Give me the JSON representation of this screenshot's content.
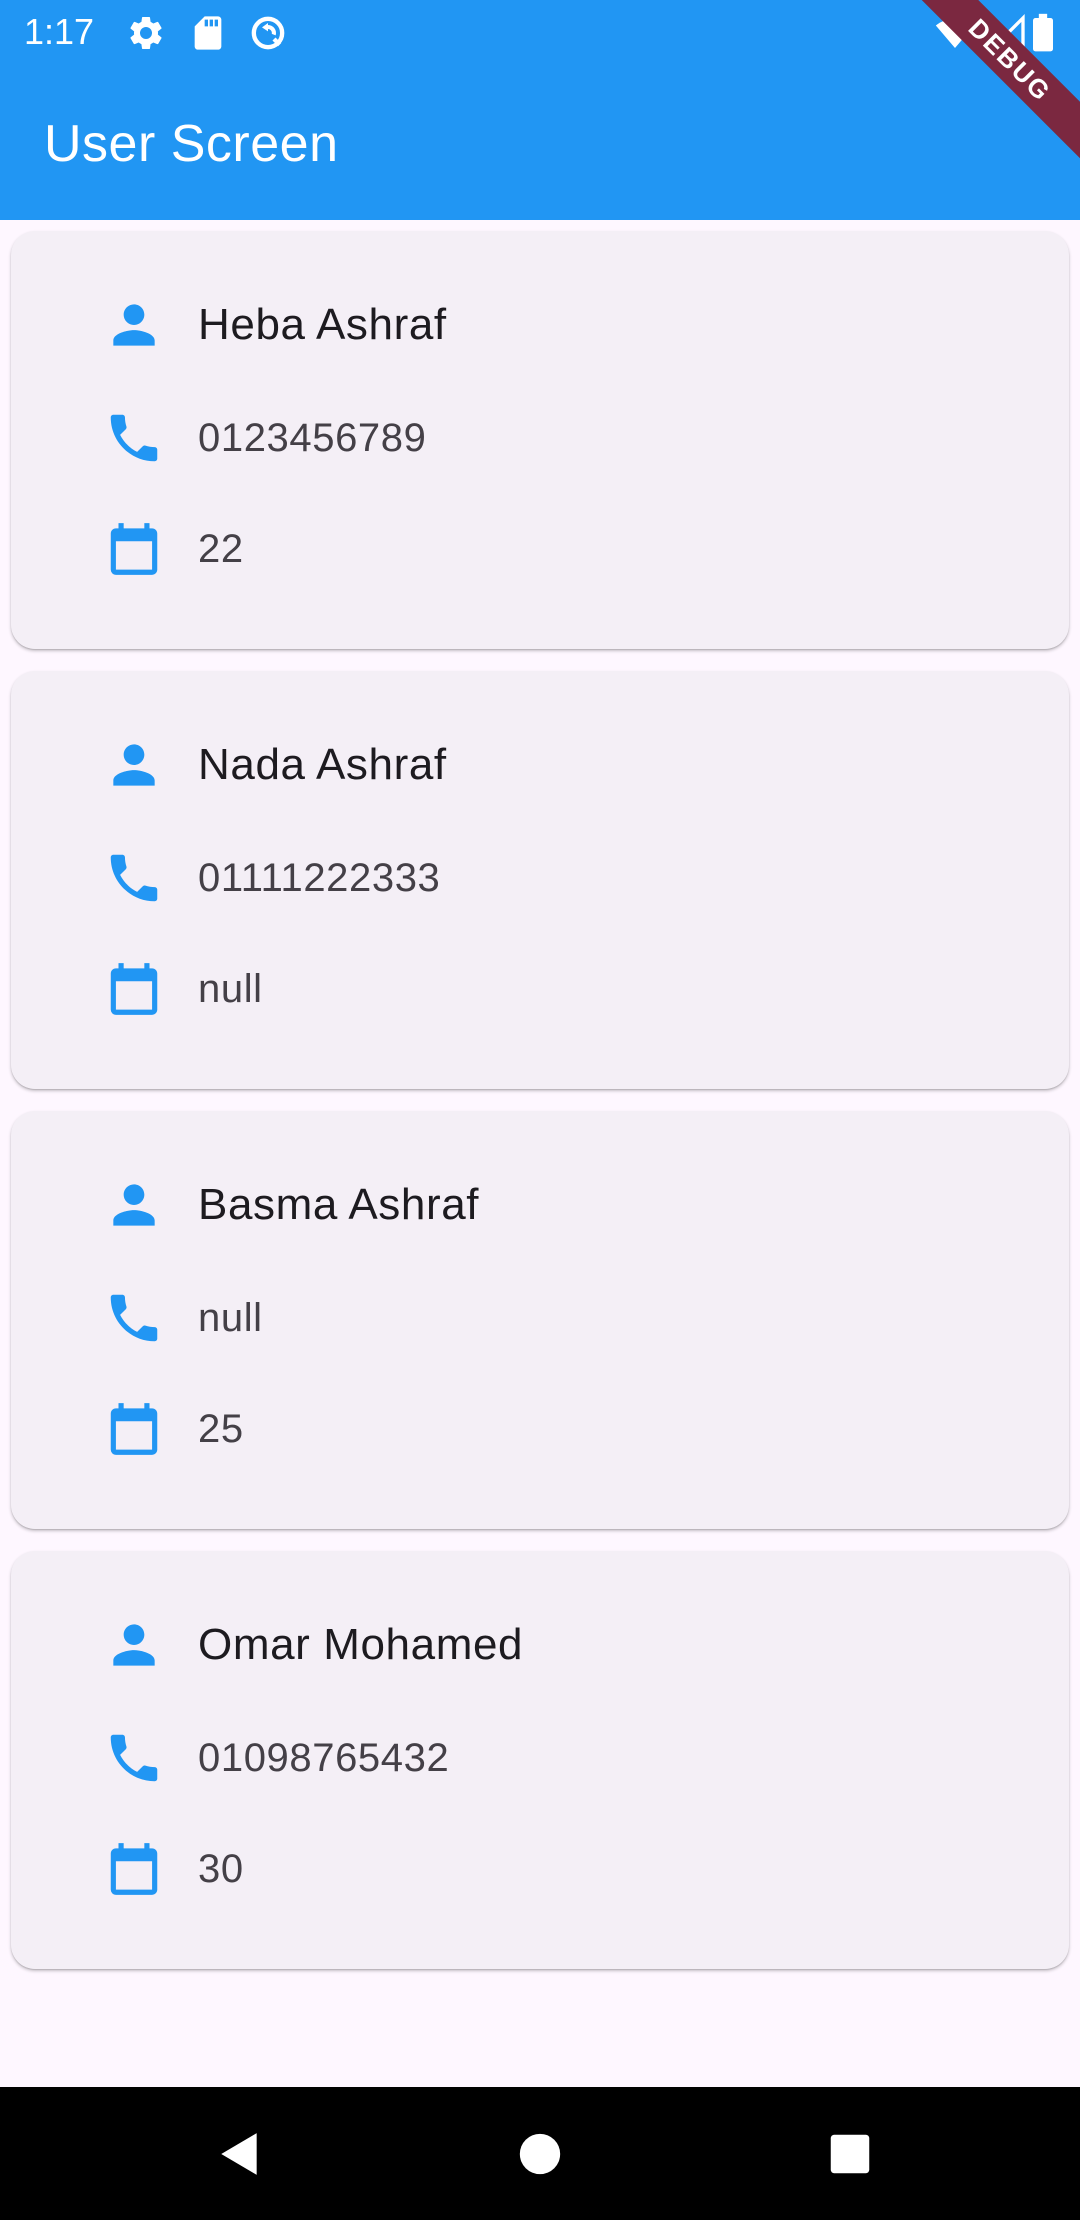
{
  "status_bar": {
    "time": "1:17",
    "left_icons": [
      "gear-icon",
      "sd-card-icon",
      "sync-icon"
    ],
    "right_icons": [
      "wifi-icon",
      "signal-icon",
      "battery-icon"
    ]
  },
  "app_bar": {
    "title": "User Screen",
    "debug_label": "DEBUG",
    "color": "#2196F3"
  },
  "users": [
    {
      "name": "Heba Ashraf",
      "phone": "0123456789",
      "age": "22"
    },
    {
      "name": "Nada Ashraf",
      "phone": "01111222333",
      "age": "null"
    },
    {
      "name": "Basma Ashraf",
      "phone": "null",
      "age": "25"
    },
    {
      "name": "Omar Mohamed",
      "phone": "01098765432",
      "age": "30"
    }
  ],
  "row_icons": {
    "name": "person-icon",
    "phone": "phone-icon",
    "age": "calendar-icon"
  },
  "nav_bar": {
    "buttons": [
      "back-icon",
      "home-icon",
      "recents-icon"
    ]
  },
  "colors": {
    "accent": "#2196F3",
    "card_background": "#F4EFF6",
    "page_background": "#FEF7FF",
    "debug_banner": "#7B2840"
  }
}
